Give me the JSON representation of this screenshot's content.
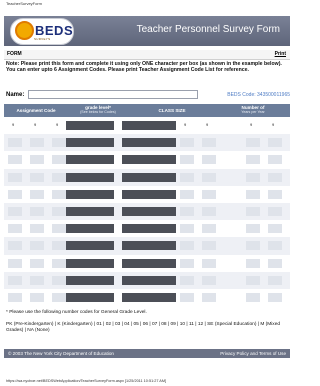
{
  "browser": {
    "tab_title": "TeacherSurveyForm",
    "status_url": "https://wa.nycboe.net/BEDSWebApplication/TeacherSurveyForm.aspx [1/25/2011 10:51:27 AM]"
  },
  "header": {
    "logo_text": "BEDS",
    "logo_subtext": "SURVEYS",
    "title": "Teacher Personnel Survey Form"
  },
  "form_bar": {
    "label": "FORM",
    "print_label": "Print"
  },
  "note": "Note: Please print this form and complete it using only ONE character per box (as shown in the example below). You can enter upto 6 Assignment Codes. Please print Teacher Assignment Code List for reference.",
  "name_field": {
    "label": "Name:",
    "value": "",
    "beds_code": "BEDS Code: 343500011965"
  },
  "table": {
    "headers": {
      "assignment_code": "Assignment Code",
      "grade_level": "grade level*",
      "grade_level_note": "(See below for Codes)",
      "class_size": "CLASS SIZE",
      "years": "Number of",
      "years_2": "Years per Year"
    },
    "example_row": {
      "a1": "9",
      "a2": "9",
      "a3": "9",
      "c1": "9",
      "c2": "9",
      "y1": "9",
      "y2": "9"
    }
  },
  "footnote": "* Please use the following number codes for General Grade Level.",
  "grade_codes": "PK (Pre-Kindergarten) | K (Kindergarten) | 01 | 02 | 03 | 04 | 05 | 06 | 07 | 08 | 09 | 10 | 11 | 12 | SE (Special Education) | M (Mixed Grades) | NA (None)",
  "footer": {
    "copyright": "© 2003 The New York City Department of Education",
    "policy": "Privacy Policy and Terms of Use"
  },
  "colors": {
    "header_bg": "#6b7286",
    "table_header_bg": "#6b7d9a",
    "link_blue": "#4d7bc4",
    "dark_box": "#4c4f57"
  }
}
